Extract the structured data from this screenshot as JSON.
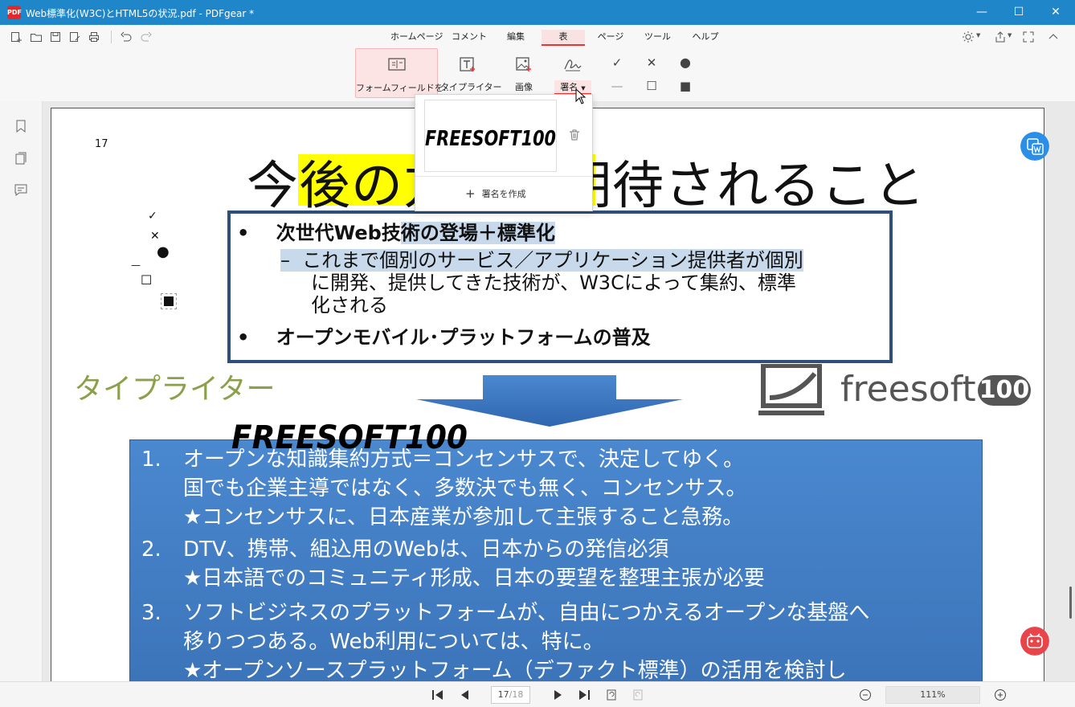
{
  "window": {
    "title": "Web標準化(W3C)とHTML5の状況.pdf - PDFgear *",
    "app_icon_text": "PDF",
    "controls": {
      "minimize": "—",
      "maximize": "☐",
      "close": "✕"
    }
  },
  "menu": {
    "tabs": [
      "ホームページ",
      "コメント",
      "編集",
      "表",
      "ページ",
      "ツール",
      "ヘルプ"
    ],
    "active_tab": "表"
  },
  "toolbar": {
    "form_field_label": "フォームフィールドを...",
    "typewriter_label": "タイプライター",
    "image_label": "画像",
    "signature_label": "署名"
  },
  "signature_dropdown": {
    "signature_text": "FREESOFT100",
    "create_label": "署名を作成"
  },
  "document": {
    "page_label": "17",
    "title_text": "今後の方向と期待されること",
    "bullet1": "次世代Web技術の登場＋標準化",
    "bullet1_plain": "次世代Web技",
    "bullet1_hl": "術の登場＋標準化",
    "sub_dash": "–",
    "sub_line1": "これまで個別のサービス／アプリケーション提供者が個別",
    "sub_line2": "に開発、提供してきた技術が、W3Cによって集約、標準",
    "sub_line3": "化される",
    "bullet2": "オープンモバイル･プラットフォームの普及",
    "bullet_mark": "•",
    "typewriter_text": "タイプライター",
    "signature_stamp": "FREESOFT100",
    "logo_text": "freesoft",
    "logo_badge": "100",
    "list": [
      {
        "num": "1.",
        "lines": [
          "オープンな知識集約方式＝コンセンサスで、決定してゆく。",
          "国でも企業主導ではなく、多数決でも無く、コンセンサス。",
          "★コンセンサスに、日本産業が参加して主張すること急務。"
        ]
      },
      {
        "num": "2.",
        "lines": [
          "DTV、携帯、組込用のWebは、日本からの発信必須",
          "★日本語でのコミュニティ形成、日本の要望を整理主張が必要"
        ]
      },
      {
        "num": "3.",
        "lines": [
          "ソフトビジネスのプラットフォームが、自由につかえるオープンな基盤へ",
          "移りつつある。Web利用については、特に。",
          "★オープンソースプラットフォーム（デファクト標準）の活用を検討し"
        ]
      }
    ]
  },
  "statusbar": {
    "current_page": "17",
    "total_pages": "/18",
    "zoom": "111%"
  },
  "colors": {
    "titlebar": "#1f86c9",
    "accent": "#e33333",
    "blue_box": "#4a88cf",
    "typewriter_green": "#8aa04a"
  }
}
